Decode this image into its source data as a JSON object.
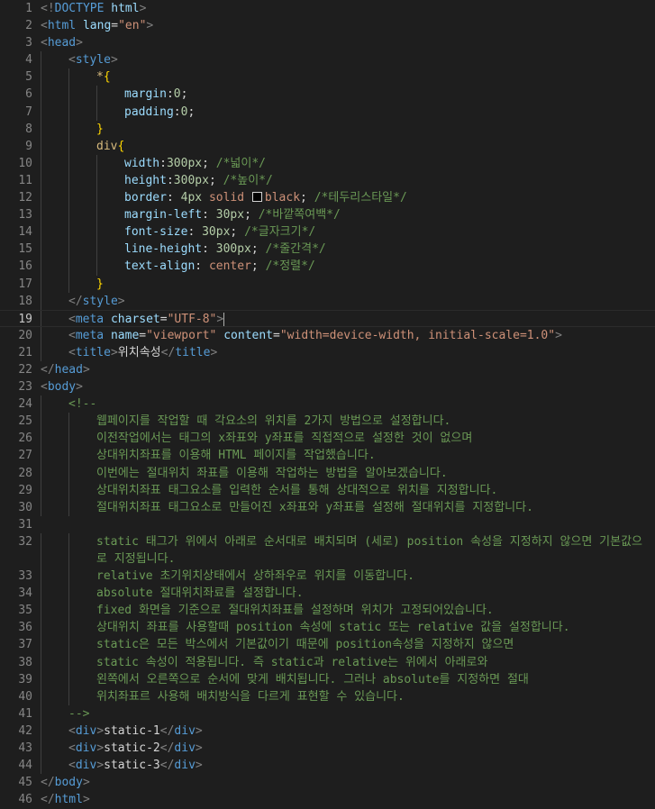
{
  "lines": [
    {
      "n": "1",
      "seg": [
        [
          "p",
          "<!"
        ],
        [
          "t",
          "DOCTYPE"
        ],
        [
          "txt",
          " "
        ],
        [
          "a",
          "html"
        ],
        [
          "p",
          ">"
        ]
      ]
    },
    {
      "n": "2",
      "seg": [
        [
          "p",
          "<"
        ],
        [
          "t",
          "html"
        ],
        [
          "txt",
          " "
        ],
        [
          "a",
          "lang"
        ],
        [
          "txt",
          "="
        ],
        [
          "s",
          "\"en\""
        ],
        [
          "p",
          ">"
        ]
      ]
    },
    {
      "n": "3",
      "seg": [
        [
          "p",
          "<"
        ],
        [
          "t",
          "head"
        ],
        [
          "p",
          ">"
        ]
      ]
    },
    {
      "n": "4",
      "indent": 1,
      "seg": [
        [
          "p",
          "<"
        ],
        [
          "t",
          "style"
        ],
        [
          "p",
          ">"
        ]
      ]
    },
    {
      "n": "5",
      "indent": 2,
      "seg": [
        [
          "sel",
          "*"
        ],
        [
          "brace",
          "{"
        ]
      ]
    },
    {
      "n": "6",
      "indent": 3,
      "seg": [
        [
          "prop",
          "margin"
        ],
        [
          "txt",
          ":"
        ],
        [
          "num",
          "0"
        ],
        [
          "txt",
          ";"
        ]
      ]
    },
    {
      "n": "7",
      "indent": 3,
      "seg": [
        [
          "prop",
          "padding"
        ],
        [
          "txt",
          ":"
        ],
        [
          "num",
          "0"
        ],
        [
          "txt",
          ";"
        ]
      ]
    },
    {
      "n": "8",
      "indent": 2,
      "seg": [
        [
          "brace",
          "}"
        ]
      ]
    },
    {
      "n": "9",
      "indent": 2,
      "seg": [
        [
          "sel",
          "div"
        ],
        [
          "brace",
          "{"
        ]
      ]
    },
    {
      "n": "10",
      "indent": 3,
      "seg": [
        [
          "prop",
          "width"
        ],
        [
          "txt",
          ":"
        ],
        [
          "num",
          "300px"
        ],
        [
          "txt",
          "; "
        ],
        [
          "c",
          "/*넓이*/"
        ]
      ]
    },
    {
      "n": "11",
      "indent": 3,
      "seg": [
        [
          "prop",
          "height"
        ],
        [
          "txt",
          ":"
        ],
        [
          "num",
          "300px"
        ],
        [
          "txt",
          "; "
        ],
        [
          "c",
          "/*높이*/"
        ]
      ]
    },
    {
      "n": "12",
      "indent": 3,
      "seg": [
        [
          "prop",
          "border"
        ],
        [
          "txt",
          ": "
        ],
        [
          "num",
          "4px"
        ],
        [
          "txt",
          " "
        ],
        [
          "val",
          "solid"
        ],
        [
          "txt",
          " "
        ],
        [
          "swatch",
          ""
        ],
        [
          "val",
          "black"
        ],
        [
          "txt",
          "; "
        ],
        [
          "c",
          "/*테두리스타일*/"
        ]
      ]
    },
    {
      "n": "13",
      "indent": 3,
      "seg": [
        [
          "prop",
          "margin-left"
        ],
        [
          "txt",
          ": "
        ],
        [
          "num",
          "30px"
        ],
        [
          "txt",
          "; "
        ],
        [
          "c",
          "/*바깥쪽여백*/"
        ]
      ]
    },
    {
      "n": "14",
      "indent": 3,
      "seg": [
        [
          "prop",
          "font-size"
        ],
        [
          "txt",
          ": "
        ],
        [
          "num",
          "30px"
        ],
        [
          "txt",
          "; "
        ],
        [
          "c",
          "/*글자크기*/"
        ]
      ]
    },
    {
      "n": "15",
      "indent": 3,
      "seg": [
        [
          "prop",
          "line-height"
        ],
        [
          "txt",
          ": "
        ],
        [
          "num",
          "300px"
        ],
        [
          "txt",
          "; "
        ],
        [
          "c",
          "/*줄간격*/"
        ]
      ]
    },
    {
      "n": "16",
      "indent": 3,
      "seg": [
        [
          "prop",
          "text-align"
        ],
        [
          "txt",
          ": "
        ],
        [
          "val",
          "center"
        ],
        [
          "txt",
          "; "
        ],
        [
          "c",
          "/*정렬*/"
        ]
      ]
    },
    {
      "n": "17",
      "indent": 2,
      "seg": [
        [
          "brace",
          "}"
        ]
      ]
    },
    {
      "n": "18",
      "indent": 1,
      "seg": [
        [
          "p",
          "</"
        ],
        [
          "t",
          "style"
        ],
        [
          "p",
          ">"
        ]
      ]
    },
    {
      "n": "19",
      "indent": 1,
      "active": true,
      "seg": [
        [
          "p",
          "<"
        ],
        [
          "t",
          "meta"
        ],
        [
          "txt",
          " "
        ],
        [
          "a",
          "charset"
        ],
        [
          "txt",
          "="
        ],
        [
          "s",
          "\"UTF-8\""
        ],
        [
          "p",
          ">"
        ],
        [
          "cursor",
          ""
        ]
      ]
    },
    {
      "n": "20",
      "indent": 1,
      "seg": [
        [
          "p",
          "<"
        ],
        [
          "t",
          "meta"
        ],
        [
          "txt",
          " "
        ],
        [
          "a",
          "name"
        ],
        [
          "txt",
          "="
        ],
        [
          "s",
          "\"viewport\""
        ],
        [
          "txt",
          " "
        ],
        [
          "a",
          "content"
        ],
        [
          "txt",
          "="
        ],
        [
          "s",
          "\"width=device-width, initial-scale=1.0\""
        ],
        [
          "p",
          ">"
        ]
      ]
    },
    {
      "n": "21",
      "indent": 1,
      "seg": [
        [
          "p",
          "<"
        ],
        [
          "t",
          "title"
        ],
        [
          "p",
          ">"
        ],
        [
          "txt",
          "위치속성"
        ],
        [
          "p",
          "</"
        ],
        [
          "t",
          "title"
        ],
        [
          "p",
          ">"
        ]
      ]
    },
    {
      "n": "22",
      "seg": [
        [
          "p",
          "</"
        ],
        [
          "t",
          "head"
        ],
        [
          "p",
          ">"
        ]
      ]
    },
    {
      "n": "23",
      "seg": [
        [
          "p",
          "<"
        ],
        [
          "t",
          "body"
        ],
        [
          "p",
          ">"
        ]
      ]
    },
    {
      "n": "24",
      "indent": 1,
      "seg": [
        [
          "c",
          "<!--"
        ]
      ]
    },
    {
      "n": "25",
      "indent": 2,
      "seg": [
        [
          "c",
          "웹페이지를 작업할 때 각요소의 위치를 2가지 방법으로 설정합니다."
        ]
      ]
    },
    {
      "n": "26",
      "indent": 2,
      "seg": [
        [
          "c",
          "이전작업에서는 태그의 x좌표와 y좌표를 직접적으로 설정한 것이 없으며"
        ]
      ]
    },
    {
      "n": "27",
      "indent": 2,
      "seg": [
        [
          "c",
          "상대위치좌표를 이용해 HTML 페이지를 작업했습니다."
        ]
      ]
    },
    {
      "n": "28",
      "indent": 2,
      "seg": [
        [
          "c",
          "이번에는 절대위치 좌표를 이용해 작업하는 방법을 알아보겠습니다."
        ]
      ]
    },
    {
      "n": "29",
      "indent": 2,
      "seg": [
        [
          "c",
          "상대위치좌표 태그요소를 입력한 순서를 통해 상대적으로 위치를 지정합니다."
        ]
      ]
    },
    {
      "n": "30",
      "indent": 2,
      "seg": [
        [
          "c",
          "절대위치좌표 태그요소로 만들어진 x좌표와 y좌표를 설정해 절대위치를 지정합니다."
        ]
      ]
    },
    {
      "n": "31",
      "seg": []
    },
    {
      "n": "32",
      "indent": 2,
      "wrapped": true,
      "seg": [
        [
          "c",
          "static 태그가 위에서 아래로 순서대로 배치되며 (세로) position 속성을 지정하지 않으면 기본값으로 지정됩니다."
        ]
      ]
    },
    {
      "n": "33",
      "indent": 2,
      "seg": [
        [
          "c",
          "relative 초기위치상태에서 상하좌우로 위치를 이동합니다."
        ]
      ]
    },
    {
      "n": "34",
      "indent": 2,
      "seg": [
        [
          "c",
          "absolute 절대위치좌료를 설정합니다."
        ]
      ]
    },
    {
      "n": "35",
      "indent": 2,
      "seg": [
        [
          "c",
          "fixed 화면을 기준으로 절대위치좌표를 설정하며 위치가 고정되어있습니다."
        ]
      ]
    },
    {
      "n": "36",
      "indent": 2,
      "seg": [
        [
          "c",
          "상대위치 좌표를 사용할때 position 속성에 static 또는 relative 값을 설정합니다."
        ]
      ]
    },
    {
      "n": "37",
      "indent": 2,
      "seg": [
        [
          "c",
          "static은 모든 박스에서 기본값이기 때문에 position속성을 지정하지 않으면"
        ]
      ]
    },
    {
      "n": "38",
      "indent": 2,
      "seg": [
        [
          "c",
          "static 속성이 적용됩니다. 즉 static과 relative는 위에서 아래로와"
        ]
      ]
    },
    {
      "n": "39",
      "indent": 2,
      "seg": [
        [
          "c",
          "왼쪽에서 오른쪽으로 순서에 맞게 배치됩니다. 그러나 absolute를 지정하면 절대"
        ]
      ]
    },
    {
      "n": "40",
      "indent": 2,
      "seg": [
        [
          "c",
          "위치좌표르 사용해 배치방식을 다르게 표현할 수 있습니다."
        ]
      ]
    },
    {
      "n": "41",
      "indent": 1,
      "seg": [
        [
          "c",
          "-->"
        ]
      ]
    },
    {
      "n": "42",
      "indent": 1,
      "seg": [
        [
          "p",
          "<"
        ],
        [
          "t",
          "div"
        ],
        [
          "p",
          ">"
        ],
        [
          "txt",
          "static-1"
        ],
        [
          "p",
          "</"
        ],
        [
          "t",
          "div"
        ],
        [
          "p",
          ">"
        ]
      ]
    },
    {
      "n": "43",
      "indent": 1,
      "seg": [
        [
          "p",
          "<"
        ],
        [
          "t",
          "div"
        ],
        [
          "p",
          ">"
        ],
        [
          "txt",
          "static-2"
        ],
        [
          "p",
          "</"
        ],
        [
          "t",
          "div"
        ],
        [
          "p",
          ">"
        ]
      ]
    },
    {
      "n": "44",
      "indent": 1,
      "seg": [
        [
          "p",
          "<"
        ],
        [
          "t",
          "div"
        ],
        [
          "p",
          ">"
        ],
        [
          "txt",
          "static-3"
        ],
        [
          "p",
          "</"
        ],
        [
          "t",
          "div"
        ],
        [
          "p",
          ">"
        ]
      ]
    },
    {
      "n": "45",
      "seg": [
        [
          "p",
          "</"
        ],
        [
          "t",
          "body"
        ],
        [
          "p",
          ">"
        ]
      ]
    },
    {
      "n": "46",
      "seg": [
        [
          "p",
          "</"
        ],
        [
          "t",
          "html"
        ],
        [
          "p",
          ">"
        ]
      ]
    }
  ]
}
